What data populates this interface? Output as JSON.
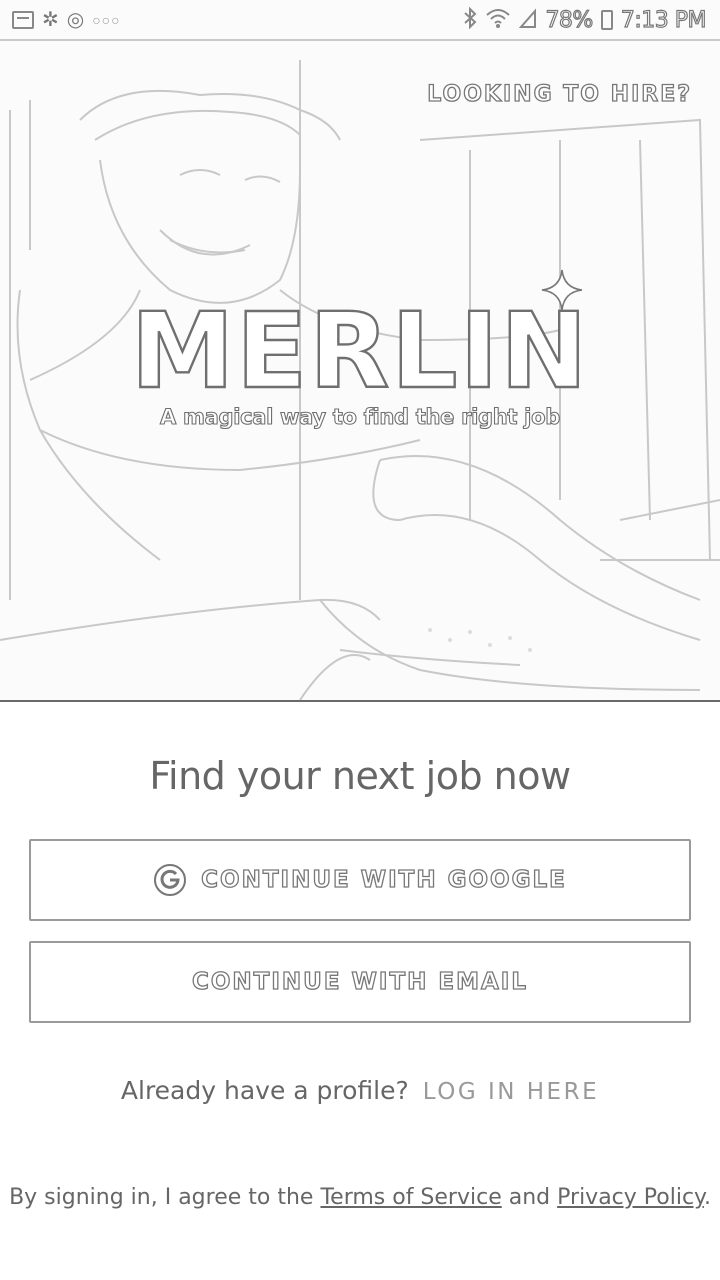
{
  "status_bar": {
    "icons_left": [
      "gallery-icon",
      "pinwheel-icon",
      "target-icon",
      "more-dots-icon"
    ],
    "icons_right": [
      "bluetooth-icon",
      "wifi-icon",
      "signal-icon",
      "battery-icon"
    ],
    "battery_percent": "78%",
    "time": "7:13 PM"
  },
  "hero": {
    "hire_link": "LOOKING TO HIRE?",
    "brand": "MERLIN",
    "tagline": "A magical way to find the right job",
    "background": "photo of smiling man at work (sketch-style)"
  },
  "auth": {
    "headline": "Find your next job now",
    "google_button": "CONTINUE WITH GOOGLE",
    "email_button": "CONTINUE WITH EMAIL",
    "login_prompt": "Already have a profile?",
    "login_link": "LOG IN HERE"
  },
  "legal": {
    "prefix": "By signing in, I agree to the",
    "terms": "Terms of Service",
    "conjunction": "and",
    "privacy": "Privacy Policy",
    "suffix": "."
  },
  "colors": {
    "outline": "#777777",
    "divider": "#6a6a6a",
    "button_border": "#9a9a9a",
    "muted_text": "#666666"
  }
}
